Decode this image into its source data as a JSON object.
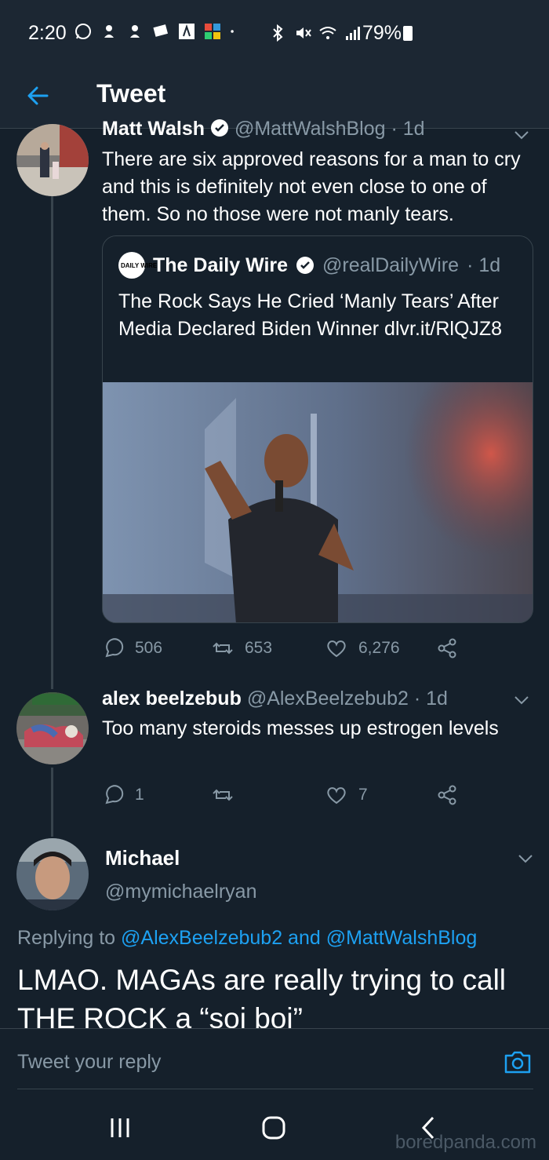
{
  "status_bar": {
    "time": "2:20",
    "battery": "79%"
  },
  "header": {
    "title": "Tweet"
  },
  "tweet1": {
    "name": "Matt Walsh",
    "handle": "@MattWalshBlog",
    "age": "· 1d",
    "text": "There are six approved reasons for a man to cry and this is definitely not even close to one of them. So no those were not manly tears."
  },
  "quote": {
    "logo_text": "DAILY WIRE",
    "name": "The Daily Wire",
    "handle": "@realDailyWire",
    "age": "· 1d",
    "text": "The Rock Says He Cried ‘Manly Tears’ After Media Declared Biden Winner dlvr.it/RlQJZ8"
  },
  "tweet1_actions": {
    "replies": "506",
    "retweets": "653",
    "likes": "6,276"
  },
  "tweet2": {
    "name": "alex beelzebub",
    "handle": "@AlexBeelzebub2",
    "age": "· 1d",
    "text": "Too many steroids messes up estrogen levels"
  },
  "tweet2_actions": {
    "replies": "1",
    "retweets": "",
    "likes": "7"
  },
  "main_tweet": {
    "name": "Michael",
    "handle": "@mymichaelryan",
    "replying_prefix": "Replying to",
    "replying_to": "@AlexBeelzebub2 and @MattWalshBlog",
    "text": "LMAO. MAGAs are really trying to call THE ROCK a “soi boi”"
  },
  "reply_box": {
    "placeholder": "Tweet your reply"
  },
  "watermark": "boredpanda.com",
  "colors": {
    "background": "#15202b",
    "accent": "#1da1f2",
    "muted": "#8899a6",
    "border": "#38444d"
  }
}
